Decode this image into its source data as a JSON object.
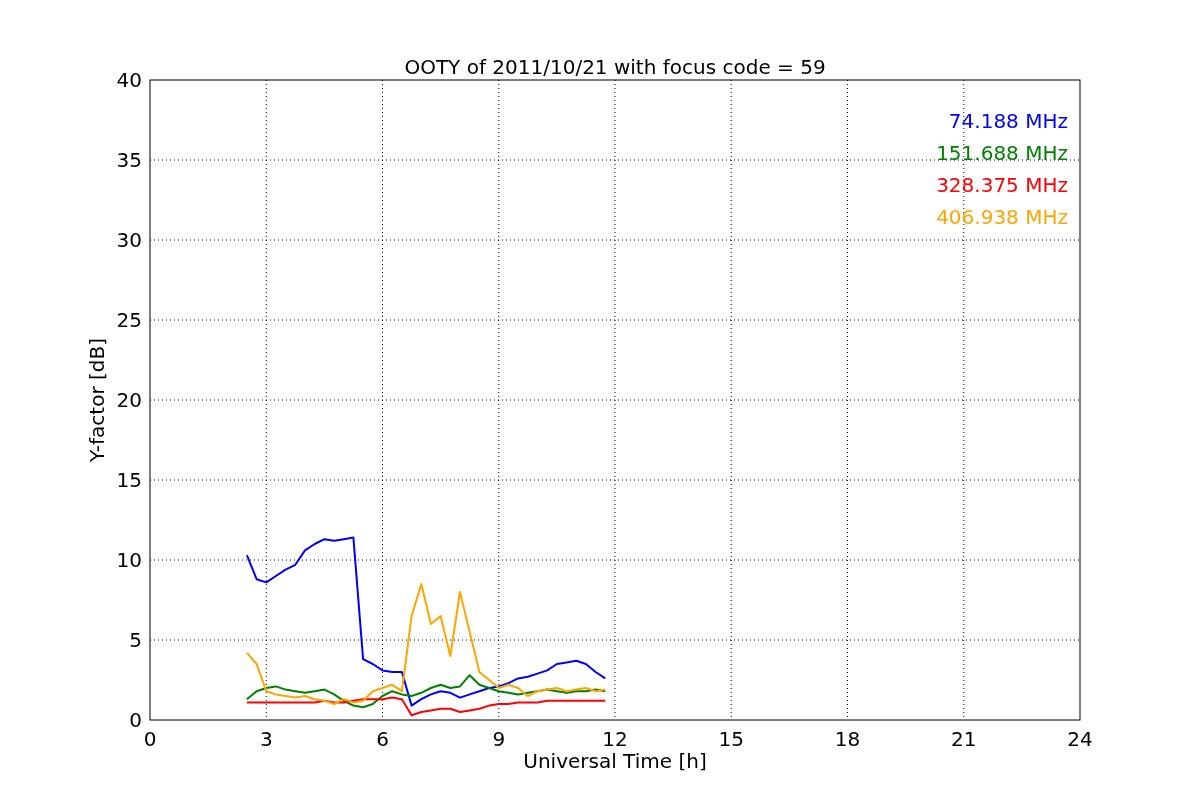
{
  "chart": {
    "chart_data": {
      "type": "line",
      "title": "OOTY of 2011/10/21 with focus code = 59",
      "xlabel": "Universal Time [h]",
      "ylabel": "Y-factor [dB]",
      "xlim": [
        0,
        24
      ],
      "ylim": [
        0,
        40
      ],
      "xticks": [
        0,
        3,
        6,
        9,
        12,
        15,
        18,
        21,
        24
      ],
      "yticks": [
        0,
        5,
        10,
        15,
        20,
        25,
        30,
        35,
        40
      ],
      "grid": true,
      "x": [
        2.5,
        2.75,
        3,
        3.25,
        3.5,
        3.75,
        4,
        4.25,
        4.5,
        4.75,
        5,
        5.25,
        5.5,
        5.75,
        6,
        6.25,
        6.5,
        6.75,
        7,
        7.25,
        7.5,
        7.75,
        8,
        8.25,
        8.5,
        8.75,
        9,
        9.25,
        9.5,
        9.75,
        10,
        10.25,
        10.5,
        10.75,
        11,
        11.25,
        11.5,
        11.75
      ],
      "series": [
        {
          "name": "74.188 MHz",
          "color": "#0000ff",
          "values": [
            10.3,
            8.8,
            8.6,
            9.0,
            9.4,
            9.7,
            10.6,
            11.0,
            11.3,
            11.2,
            11.3,
            11.4,
            3.8,
            3.5,
            3.1,
            3.0,
            3.0,
            0.9,
            1.3,
            1.6,
            1.8,
            1.7,
            1.4,
            1.6,
            1.8,
            2.0,
            2.1,
            2.3,
            2.6,
            2.7,
            2.9,
            3.1,
            3.5,
            3.6,
            3.7,
            3.5,
            3.0,
            2.6
          ]
        },
        {
          "name": "151.688 MHz",
          "color": "#008000",
          "values": [
            1.3,
            1.8,
            2.0,
            2.1,
            1.9,
            1.8,
            1.7,
            1.8,
            1.9,
            1.6,
            1.2,
            0.9,
            0.8,
            1.0,
            1.5,
            1.8,
            1.6,
            1.5,
            1.7,
            2.0,
            2.2,
            2.0,
            2.1,
            2.8,
            2.2,
            2.0,
            1.8,
            1.7,
            1.6,
            1.7,
            1.8,
            1.9,
            1.8,
            1.7,
            1.8,
            1.8,
            1.9,
            1.8
          ]
        },
        {
          "name": "328.375 MHz",
          "color": "#ff0000",
          "values": [
            1.1,
            1.1,
            1.1,
            1.1,
            1.1,
            1.1,
            1.1,
            1.1,
            1.2,
            1.1,
            1.1,
            1.2,
            1.3,
            1.3,
            1.3,
            1.4,
            1.3,
            0.3,
            0.5,
            0.6,
            0.7,
            0.7,
            0.5,
            0.6,
            0.7,
            0.9,
            1.0,
            1.0,
            1.1,
            1.1,
            1.1,
            1.2,
            1.2,
            1.2,
            1.2,
            1.2,
            1.2,
            1.2
          ]
        },
        {
          "name": "406.938 MHz",
          "color": "#ffa500",
          "values": [
            4.2,
            3.5,
            1.8,
            1.6,
            1.5,
            1.4,
            1.5,
            1.3,
            1.2,
            1.0,
            1.3,
            1.1,
            1.2,
            1.8,
            2.0,
            2.2,
            1.8,
            6.5,
            8.5,
            6.0,
            6.5,
            4.0,
            8.0,
            5.5,
            3.0,
            2.5,
            2.0,
            2.2,
            2.0,
            1.5,
            1.8,
            1.9,
            2.0,
            1.8,
            1.9,
            2.0,
            1.8,
            1.9
          ]
        }
      ]
    }
  }
}
